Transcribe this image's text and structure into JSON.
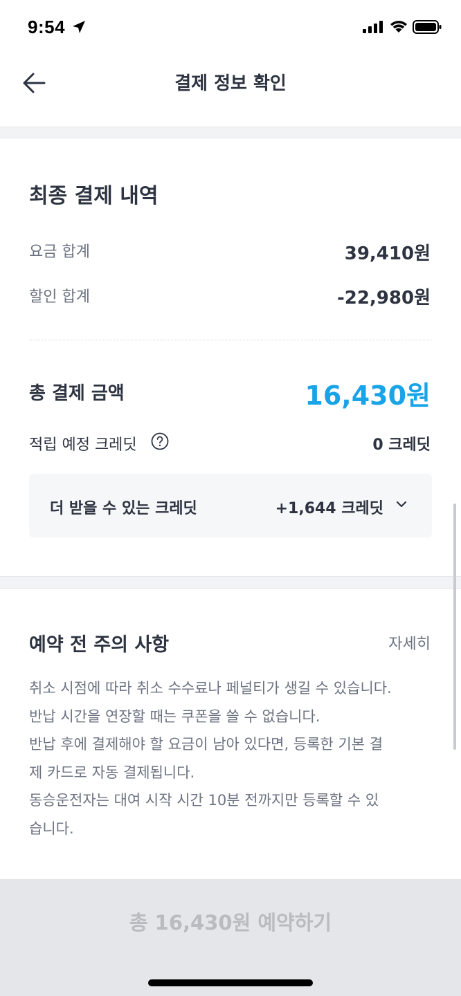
{
  "status_bar": {
    "time": "9:54",
    "icons": [
      "location-arrow-icon",
      "signal-icon",
      "wifi-icon",
      "battery-icon"
    ]
  },
  "header": {
    "title": "결제 정보 확인",
    "back_icon": "arrow-left-icon"
  },
  "payment": {
    "title": "최종 결제 내역",
    "fee_total_label": "요금 합계",
    "fee_total_value": "39,410원",
    "discount_total_label": "할인 합계",
    "discount_total_value": "-22,980원",
    "grand_total_label": "총 결제 금액",
    "grand_total_value": "16,430원",
    "accrual_credit_label": "적립 예정 크레딧",
    "accrual_credit_value": "0 크레딧",
    "more_credit_label": "더 받을 수 있는 크레딧",
    "more_credit_value": "+1,644 크레딧"
  },
  "notice": {
    "title": "예약 전 주의 사항",
    "detail_link": "자세히",
    "lines": [
      "취소 시점에 따라 취소 수수료나 페널티가 생길 수 있습니다.",
      "반납 시간을 연장할 때는 쿠폰을 쓸 수 없습니다.",
      "반납 후에 결제해야 할 요금이 남아 있다면, 등록한 기본 결",
      "제 카드로 자동 결제됩니다.",
      "동승운전자는 대여 시작 시간 10분 전까지만 등록할 수 있",
      "습니다."
    ]
  },
  "footer": {
    "reserve_button_label": "총 16,430원 예약하기"
  },
  "colors": {
    "accent": "#1aa4e8",
    "text_primary": "#2d3340",
    "text_secondary": "#6b7280",
    "button_disabled_bg": "#e5e6e9",
    "button_disabled_text": "#b8bbc0"
  }
}
